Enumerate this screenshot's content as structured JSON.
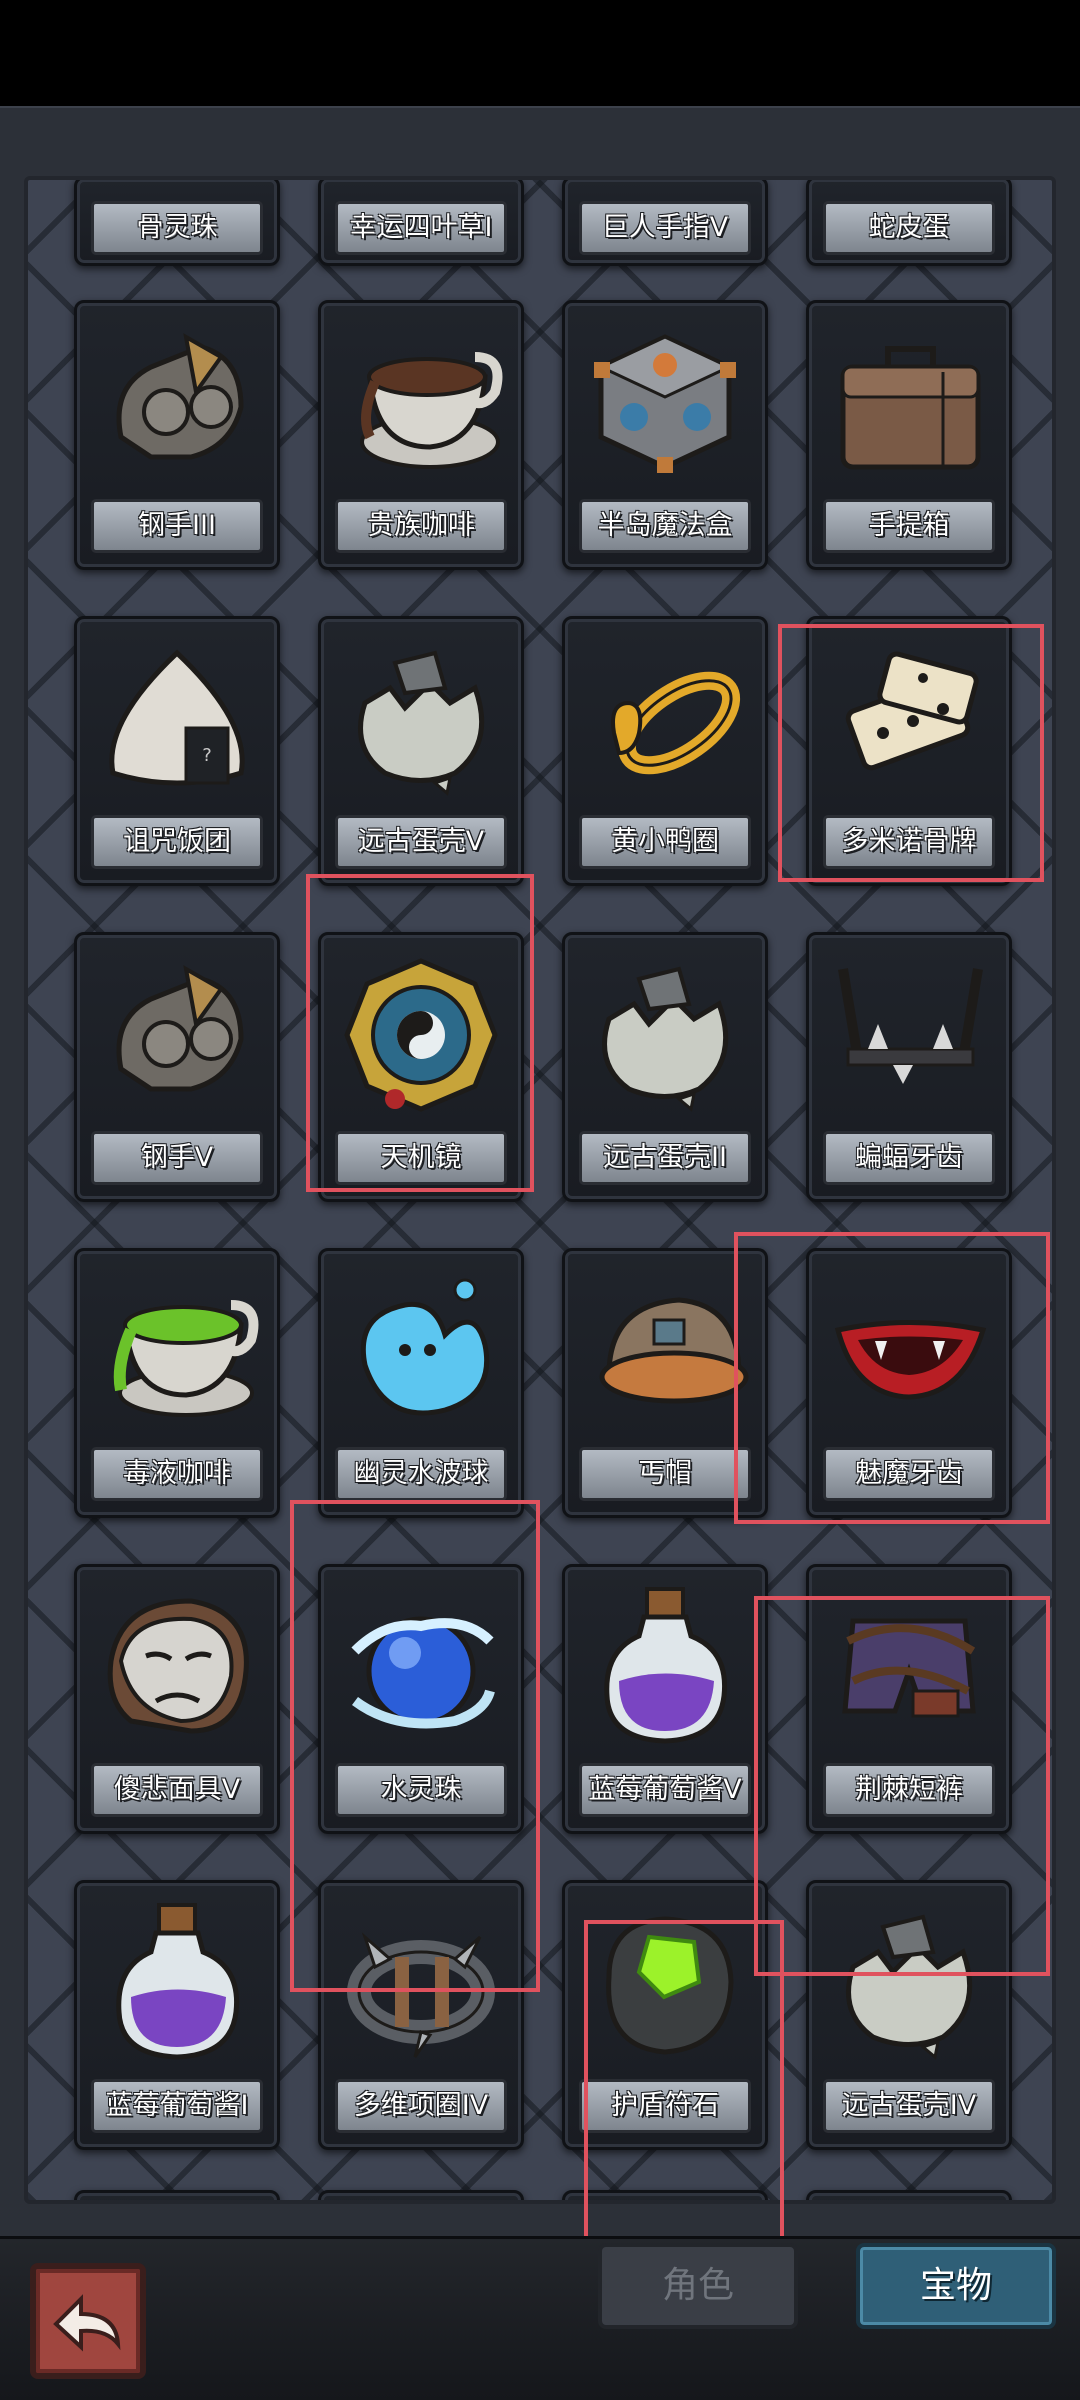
{
  "colors": {
    "highlight": "#e0525e",
    "panel": "#3e4452",
    "label_bg": "#9aa1aa",
    "tab_active": "#2f5f77"
  },
  "top_row": [
    {
      "name": "骨灵珠"
    },
    {
      "name": "幸运四叶草I"
    },
    {
      "name": "巨人手指V"
    },
    {
      "name": "蛇皮蛋"
    }
  ],
  "items": [
    {
      "name": "钢手III",
      "icon": "gauntlet-icon"
    },
    {
      "name": "贵族咖啡",
      "icon": "coffee-cup-icon"
    },
    {
      "name": "半岛魔法盒",
      "icon": "magic-cube-icon"
    },
    {
      "name": "手提箱",
      "icon": "suitcase-icon"
    },
    {
      "name": "诅咒饭团",
      "icon": "rice-ball-icon"
    },
    {
      "name": "远古蛋壳V",
      "icon": "eggshell-icon"
    },
    {
      "name": "黄小鸭圈",
      "icon": "duck-ring-icon"
    },
    {
      "name": "多米诺骨牌",
      "icon": "domino-icon"
    },
    {
      "name": "钢手V",
      "icon": "gauntlet-icon"
    },
    {
      "name": "天机镜",
      "icon": "bagua-mirror-icon"
    },
    {
      "name": "远古蛋壳II",
      "icon": "eggshell-icon"
    },
    {
      "name": "蝙蝠牙齿",
      "icon": "bat-fangs-icon"
    },
    {
      "name": "毒液咖啡",
      "icon": "poison-coffee-icon"
    },
    {
      "name": "幽灵水波球",
      "icon": "water-blob-icon"
    },
    {
      "name": "丐帽",
      "icon": "beanie-hat-icon"
    },
    {
      "name": "魅魔牙齿",
      "icon": "succubus-lips-icon"
    },
    {
      "name": "傻悲面具V",
      "icon": "sad-mask-icon"
    },
    {
      "name": "水灵珠",
      "icon": "water-orb-icon"
    },
    {
      "name": "蓝莓葡萄酱V",
      "icon": "potion-jar-icon"
    },
    {
      "name": "荆棘短裤",
      "icon": "thorn-shorts-icon"
    },
    {
      "name": "蓝莓葡萄酱I",
      "icon": "potion-jar-icon"
    },
    {
      "name": "多维项圈IV",
      "icon": "spiked-collar-icon"
    },
    {
      "name": "护盾符石",
      "icon": "rune-stone-icon"
    },
    {
      "name": "远古蛋壳IV",
      "icon": "eggshell-icon"
    }
  ],
  "bottom": {
    "back_icon": "back-arrow-icon",
    "tab_role": "角色",
    "tab_treasure": "宝物"
  }
}
